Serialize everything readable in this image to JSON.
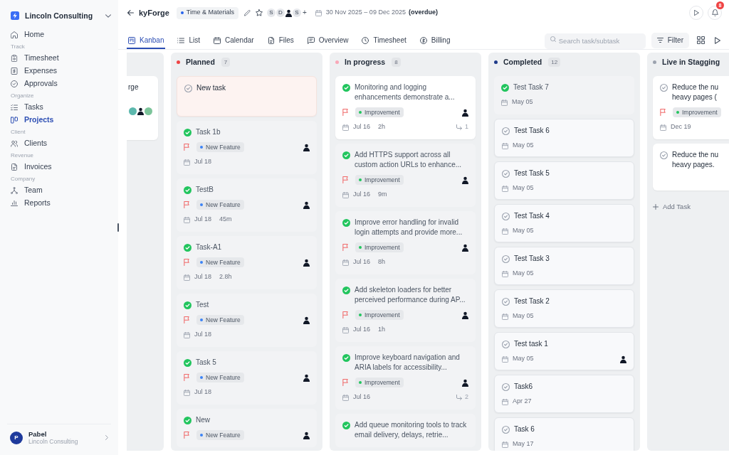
{
  "sidebar": {
    "workspace": "Lincoln Consulting",
    "groups": [
      {
        "items": [
          {
            "label": "Home",
            "selected": false
          }
        ]
      },
      {
        "label": "Track",
        "items": [
          {
            "label": "Timesheet",
            "selected": false
          },
          {
            "label": "Expenses",
            "selected": false
          },
          {
            "label": "Approvals",
            "selected": false
          }
        ]
      },
      {
        "label": "Organize",
        "items": [
          {
            "label": "Tasks",
            "selected": false
          },
          {
            "label": "Projects",
            "selected": true
          }
        ]
      },
      {
        "label": "Client",
        "items": [
          {
            "label": "Clients",
            "selected": false
          }
        ]
      },
      {
        "label": "Revenue",
        "items": [
          {
            "label": "Invoices",
            "selected": false
          }
        ]
      },
      {
        "label": "Company",
        "items": [
          {
            "label": "Team",
            "selected": false
          },
          {
            "label": "Reports",
            "selected": false
          }
        ]
      }
    ],
    "user": {
      "initial": "P",
      "name": "Pabel",
      "organization": "Lincoln Consulting"
    }
  },
  "header": {
    "project": "kyForge",
    "billing_type": "Time & Materials",
    "members": [
      {
        "kind": "initial",
        "text": "S"
      },
      {
        "kind": "initial",
        "text": "D"
      },
      {
        "kind": "photo"
      },
      {
        "kind": "initial",
        "text": "S"
      }
    ],
    "add_member": "+",
    "date_range": "30 Nov 2025 – 09 Dec 2025",
    "date_status": "(overdue)",
    "notification_count": "8"
  },
  "tabs": [
    {
      "label": "Kanban",
      "selected": true
    },
    {
      "label": "List",
      "selected": false
    },
    {
      "label": "Calendar",
      "selected": false
    },
    {
      "label": "Files",
      "selected": false
    },
    {
      "label": "Overview",
      "selected": false
    },
    {
      "label": "Timesheet",
      "selected": false
    },
    {
      "label": "Billing",
      "selected": false
    }
  ],
  "search": {
    "placeholder": "Search task/subtask"
  },
  "filter": {
    "label": "Filter"
  },
  "columns": [
    {
      "cards": [
        {
          "kind": "raised",
          "title": "rge",
          "members": [
            {
              "kind": "badge",
              "color": "#5cb8ad"
            },
            {
              "kind": "photo"
            },
            {
              "kind": "badge",
              "color": "#7cc49a"
            }
          ]
        }
      ]
    },
    {
      "title": "Planned",
      "color": "#ef4444",
      "count": "7",
      "cards": [
        {
          "kind": "draft",
          "done": false,
          "title": "New task",
          "flagged": false,
          "assigned": false
        },
        {
          "kind": "plain",
          "done": true,
          "title": "Task 1b",
          "flagged": true,
          "tag": {
            "label": "New Feature",
            "color": "#3b82f6"
          },
          "assigned": true,
          "date": "Jul 18"
        },
        {
          "kind": "plain",
          "done": true,
          "title": "TestB",
          "flagged": true,
          "tag": {
            "label": "New Feature",
            "color": "#3b82f6"
          },
          "assigned": true,
          "date": "Jul 18",
          "duration": "45m"
        },
        {
          "kind": "plain",
          "done": true,
          "title": "Task-A1",
          "flagged": true,
          "tag": {
            "label": "New Feature",
            "color": "#3b82f6"
          },
          "assigned": true,
          "date": "Jul 18",
          "duration": "2.8h"
        },
        {
          "kind": "plain",
          "done": true,
          "title": "Test",
          "flagged": true,
          "tag": {
            "label": "New Feature",
            "color": "#3b82f6"
          },
          "assigned": true,
          "date": "Jul 18"
        },
        {
          "kind": "plain",
          "done": true,
          "title": "Task 5",
          "flagged": true,
          "tag": {
            "label": "New Feature",
            "color": "#3b82f6"
          },
          "assigned": true,
          "date": "Jul 18"
        },
        {
          "kind": "plain",
          "done": true,
          "title": "New",
          "flagged": true,
          "tag": {
            "label": "New Feature",
            "color": "#3b82f6"
          },
          "assigned": true
        }
      ]
    },
    {
      "title": "In progress",
      "color": "#f9a8b8",
      "count": "8",
      "cards": [
        {
          "kind": "raised",
          "done": true,
          "title": "Monitoring and logging enhancements demonstrate a...",
          "flagged": true,
          "tag": {
            "label": "Improvement",
            "color": "#22c55e"
          },
          "assigned": true,
          "date": "Jul 16",
          "duration": "2h",
          "subtasks": "1"
        },
        {
          "kind": "plain",
          "done": true,
          "title": "Add HTTPS support across all custom action URLs to enhance...",
          "flagged": true,
          "tag": {
            "label": "Improvement",
            "color": "#22c55e"
          },
          "assigned": true,
          "date": "Jul 16",
          "duration": "9m"
        },
        {
          "kind": "plain",
          "done": true,
          "title": "Improve error handling for invalid login attempts and provide more...",
          "flagged": true,
          "tag": {
            "label": "Improvement",
            "color": "#22c55e"
          },
          "assigned": true,
          "date": "Jul 16",
          "duration": "8h"
        },
        {
          "kind": "plain",
          "done": true,
          "title": "Add skeleton loaders for better perceived performance during AP...",
          "flagged": true,
          "tag": {
            "label": "Improvement",
            "color": "#22c55e"
          },
          "assigned": true,
          "date": "Jul 16",
          "duration": "1h"
        },
        {
          "kind": "plain",
          "done": true,
          "title": "Improve keyboard navigation and ARIA labels for accessibility...",
          "flagged": true,
          "tag": {
            "label": "Improvement",
            "color": "#22c55e"
          },
          "assigned": true,
          "date": "Jul 16",
          "subtasks": "2"
        },
        {
          "kind": "plain",
          "done": true,
          "title": "Add queue monitoring tools to track email delivery, delays, retrie..."
        }
      ]
    },
    {
      "title": "Completed",
      "color": "#1e3a8a",
      "count": "12",
      "cards": [
        {
          "kind": "plain",
          "done": true,
          "title": "Test Task 7",
          "assigned": false,
          "date": "May 05"
        },
        {
          "kind": "bordered",
          "done": false,
          "title": "Test Task 6",
          "assigned": false,
          "date": "May 05"
        },
        {
          "kind": "bordered",
          "done": false,
          "title": "Test Task 5",
          "assigned": false,
          "date": "May 05"
        },
        {
          "kind": "bordered",
          "done": false,
          "title": "Test Task 4",
          "assigned": false,
          "date": "May 05"
        },
        {
          "kind": "bordered",
          "done": false,
          "title": "Test Task 3",
          "assigned": false,
          "date": "May 05"
        },
        {
          "kind": "bordered",
          "done": false,
          "title": "Test Task 2",
          "assigned": false,
          "date": "May 05"
        },
        {
          "kind": "bordered",
          "done": false,
          "title": "Test task 1",
          "assigned": true,
          "date": "May 05"
        },
        {
          "kind": "bordered",
          "done": false,
          "title": "Task6",
          "assigned": false,
          "date": "Apr 27"
        },
        {
          "kind": "bordered",
          "done": false,
          "title": "Task 6",
          "assigned": false,
          "date": "May 17"
        }
      ]
    },
    {
      "title": "Live in Stagging",
      "color": "#9ca3af",
      "cards": [
        {
          "kind": "raised",
          "done": false,
          "title": "Reduce the nu\nheavy pages (",
          "flagged": true,
          "tag": {
            "label": "Improvement",
            "color": "#22c55e"
          },
          "date": "Dec 19"
        },
        {
          "kind": "raised",
          "done": false,
          "title": "Reduce the nu\nheavy pages."
        }
      ],
      "add_task": "Add Task"
    }
  ]
}
